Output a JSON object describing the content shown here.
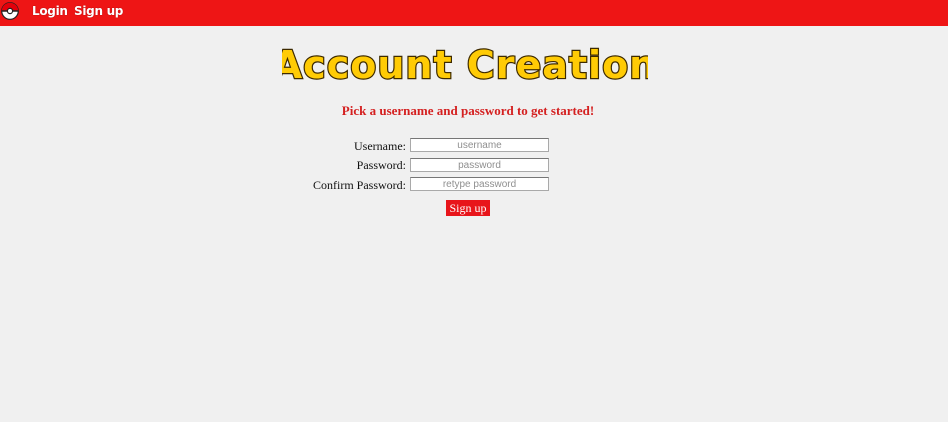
{
  "nav": {
    "login_label": "Login",
    "signup_label": "Sign up"
  },
  "page": {
    "title": "Account Creation",
    "subtitle": "Pick a username and password to get started!"
  },
  "form": {
    "username_label": "Username:",
    "username_placeholder": "username",
    "username_value": "",
    "password_label": "Password:",
    "password_placeholder": "password",
    "password_value": "",
    "confirm_label": "Confirm Password:",
    "confirm_placeholder": "retype password",
    "confirm_value": "",
    "submit_label": "Sign up"
  },
  "colors": {
    "brand_red": "#ee1515",
    "title_yellow": "#ffcb05",
    "title_outline": "#3d2a00",
    "subtitle_red": "#d42020",
    "background": "#f0f0f0"
  },
  "icons": {
    "logo": "pokeball-icon"
  }
}
